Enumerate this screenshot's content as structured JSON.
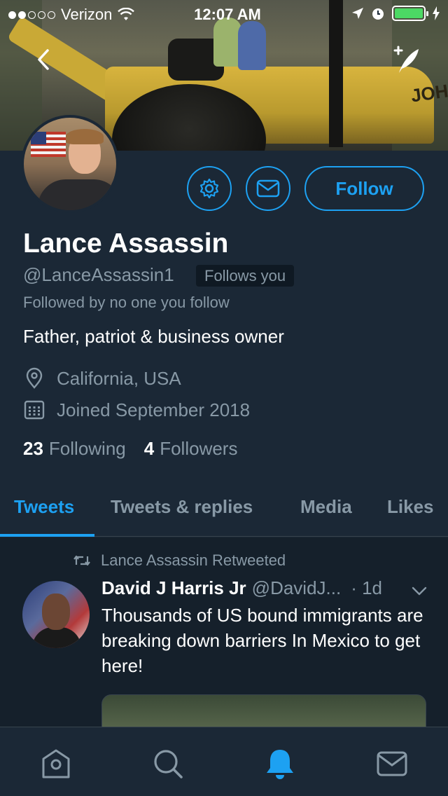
{
  "status_bar": {
    "carrier": "Verizon",
    "time": "12:07 AM",
    "battery_color": "#4cd964"
  },
  "header": {
    "back_icon": "chevron-left-icon",
    "compose_icon": "compose-tweet-icon",
    "banner_text": "JOH"
  },
  "profile": {
    "name": "Lance Assassin",
    "handle": "@LanceAssassin1",
    "follows_you_badge": "Follows you",
    "followed_by": "Followed by no one you follow",
    "bio": "Father, patriot & business owner",
    "location": "California, USA",
    "joined": "Joined September 2018",
    "following_count": "23",
    "following_label": "Following",
    "followers_count": "4",
    "followers_label": "Followers"
  },
  "actions": {
    "settings_icon": "gear-icon",
    "message_icon": "envelope-icon",
    "follow_label": "Follow",
    "accent_color": "#1da1f2"
  },
  "tabs": [
    {
      "label": "Tweets",
      "active": true
    },
    {
      "label": "Tweets & replies",
      "active": false
    },
    {
      "label": "Media",
      "active": false
    },
    {
      "label": "Likes",
      "active": false
    }
  ],
  "tweet": {
    "retweet_label": "Lance Assassin Retweeted",
    "author_name": "David J Harris Jr",
    "author_handle": "@DavidJ...",
    "time": "· 1d",
    "text": "Thousands of US bound immigrants are breaking down barriers In Mexico to get here!"
  },
  "bottom_nav": [
    {
      "icon": "home-icon",
      "active": false
    },
    {
      "icon": "search-icon",
      "active": false
    },
    {
      "icon": "notifications-bell-icon",
      "active": true
    },
    {
      "icon": "messages-envelope-icon",
      "active": false
    }
  ],
  "colors": {
    "background": "#1b2836",
    "tweet_background": "#15202b",
    "secondary_text": "#8899a6",
    "divider": "#38444d"
  }
}
